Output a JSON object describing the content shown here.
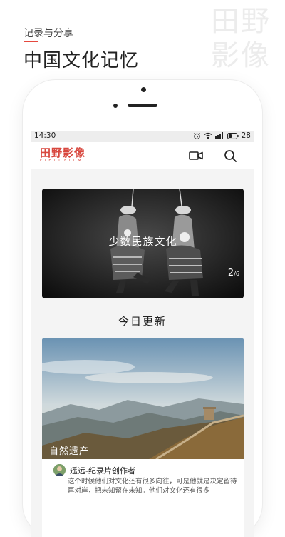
{
  "hero": {
    "subtitle": "记录与分享",
    "title": "中国文化记忆",
    "watermark": "田野影像"
  },
  "status_bar": {
    "time": "14:30",
    "battery": "28",
    "icons": [
      "alarm-icon",
      "wifi-icon",
      "signal-icon",
      "battery-icon"
    ]
  },
  "app_bar": {
    "logo_text": "田野影像",
    "logo_subtext": "FIELDFILM",
    "actions": [
      "video-icon",
      "search-icon"
    ]
  },
  "banner": {
    "title": "少数民族文化",
    "current": "2",
    "total": "/6"
  },
  "section": {
    "title": "今日更新"
  },
  "card": {
    "badge": "自然遗产",
    "author": "遥远-纪录片创作者",
    "description": "这个时候他们对文化还有很多向往，可是他就是决定留待再对岸，把未知留在未知。他们对文化还有很多"
  },
  "colors": {
    "brand": "#d8473e",
    "accent_line": "#e5483e"
  }
}
